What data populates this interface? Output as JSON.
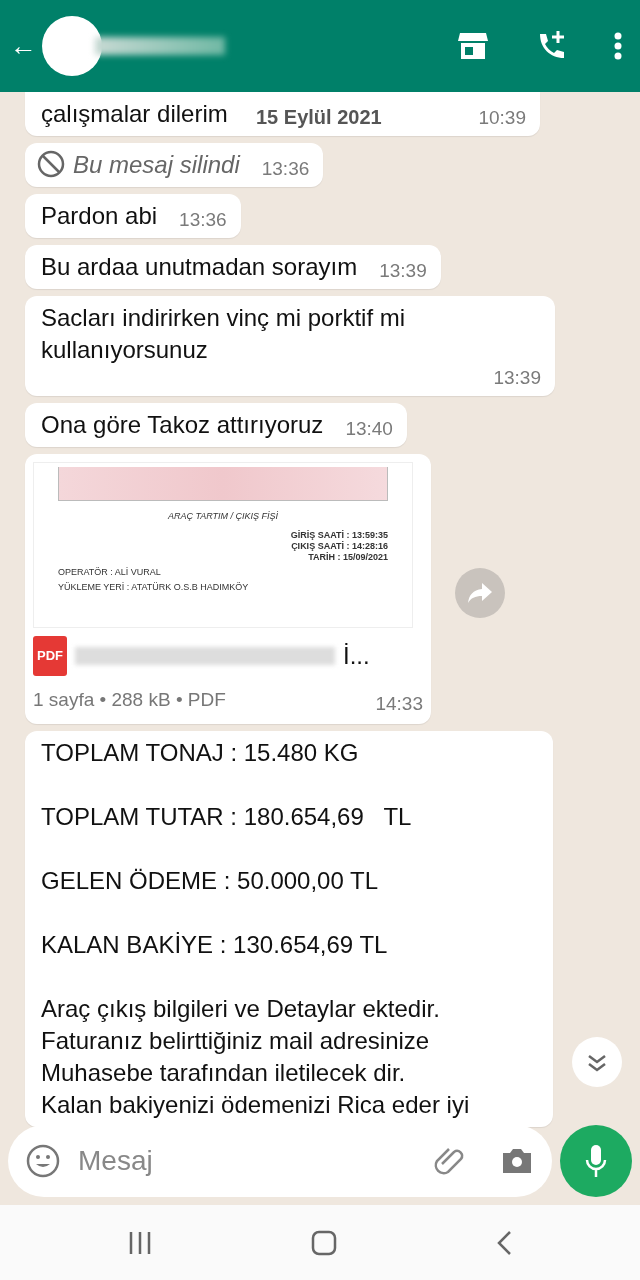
{
  "header": {
    "back": "←"
  },
  "date_chip": "15 Eylül 2021",
  "messages": [
    {
      "kind": "text",
      "text": "çalışmalar dilerim",
      "time": "10:39"
    },
    {
      "kind": "deleted",
      "text": "Bu mesaj silindi",
      "time": "13:36"
    },
    {
      "kind": "text",
      "text": "Pardon abi",
      "time": "13:36"
    },
    {
      "kind": "text",
      "text": "Bu ardaa unutmadan sorayım",
      "time": "13:39"
    },
    {
      "kind": "text",
      "text": "Sacları indirirken vinç mi porktif mi kullanıyorsunuz",
      "time": "13:39"
    },
    {
      "kind": "text",
      "text": "Ona göre Takoz attırıyoruz",
      "time": "13:40"
    },
    {
      "kind": "document",
      "preview": {
        "title": "ARAÇ TARTIM / ÇIKIŞ FİŞİ",
        "times": [
          "GİRİŞ SAATİ : 13:59:35",
          "ÇIKIŞ SAATİ : 14:28:16",
          "TARİH : 15/09/2021"
        ],
        "fields": [
          "OPERATÖR : ALİ VURAL",
          "YÜKLEME YERİ : ATATÜRK O.S.B HADIMKÖY"
        ]
      },
      "badge": "PDF",
      "file_name": "İ...",
      "meta": "1 sayfa • 288 kB • PDF",
      "time": "14:33"
    },
    {
      "kind": "text",
      "text": "TOPLAM TONAJ : 15.480 KG\n\nTOPLAM TUTAR : 180.654,69   TL\n\nGELEN ÖDEME : 50.000,00 TL\n\nKALAN BAKİYE : 130.654,69 TL\n\nAraç çıkış bilgileri ve Detaylar ektedir.\nFaturanız belirttiğiniz mail adresinize\nMuhasebe tarafından iletilecek dir.\nKalan bakiyenizi ödemenizi Rica eder iyi"
    }
  ],
  "composer": {
    "placeholder": "Mesaj"
  }
}
